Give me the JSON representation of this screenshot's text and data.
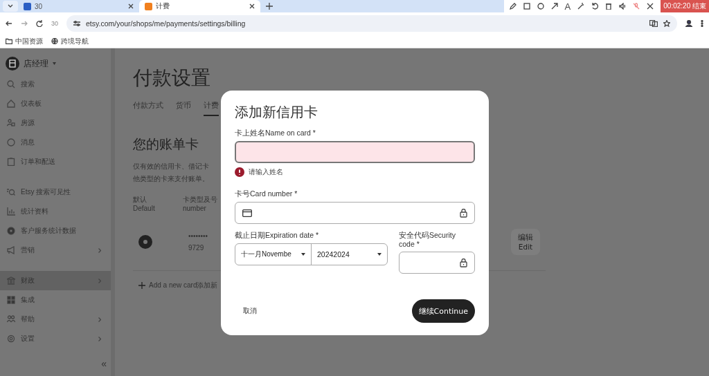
{
  "browser": {
    "tabs": [
      {
        "label": "30",
        "selected": false
      },
      {
        "label": "计费",
        "selected": true
      }
    ],
    "recorder": {
      "text_tool": "A",
      "timer": "00:02:20 结束"
    },
    "reload_badge": "30",
    "url": "etsy.com/your/shops/me/payments/settings/billing",
    "bookmarks": [
      "中国资源",
      "跨境导航"
    ]
  },
  "sidebar": {
    "shop": "店经理",
    "sections": [
      {
        "items": [
          {
            "label": "搜索",
            "selected": false,
            "submenu": false
          },
          {
            "label": "仪表板",
            "selected": false,
            "submenu": false
          },
          {
            "label": "房源",
            "selected": false,
            "submenu": false
          },
          {
            "label": "消息",
            "selected": false,
            "submenu": false
          },
          {
            "label": "订单和配送",
            "selected": false,
            "submenu": false
          }
        ]
      },
      {
        "items": [
          {
            "label": "Etsy 搜索可见性",
            "selected": false,
            "submenu": false
          },
          {
            "label": "统计资料",
            "selected": false,
            "submenu": false
          },
          {
            "label": "客户服务统计数据",
            "selected": false,
            "submenu": false
          },
          {
            "label": "营销",
            "selected": false,
            "submenu": true
          }
        ]
      },
      {
        "items": [
          {
            "label": "财政",
            "selected": true,
            "submenu": true
          },
          {
            "label": "集成",
            "selected": false,
            "submenu": false
          },
          {
            "label": "帮助",
            "selected": false,
            "submenu": true
          },
          {
            "label": "设置",
            "selected": false,
            "submenu": true
          }
        ]
      }
    ],
    "collapse": "«"
  },
  "page": {
    "title": "付款设置",
    "tabs": [
      {
        "label": "付款方式",
        "selected": false
      },
      {
        "label": "货币",
        "selected": false
      },
      {
        "label": "计费",
        "selected": true
      }
    ],
    "heading": "您的账单卡",
    "description_lines": [
      "仅有效的信用卡、借记卡",
      "他类型的卡来支付账单。"
    ],
    "table": {
      "columns": [
        [
          "默认",
          "Default"
        ],
        [
          "卡类型及号",
          "number"
        ]
      ],
      "rows": [
        {
          "selected": true,
          "card_mask": "••••••••",
          "card_last4": "9729",
          "edit": [
            "编辑",
            "Edit"
          ]
        }
      ]
    },
    "add_card": "Add a new card添加新"
  },
  "dialog": {
    "title": "添加新信用卡",
    "name_field": {
      "label": "卡上姓名Name on card *",
      "error": true,
      "error_message": "请输入姓名"
    },
    "card_field": {
      "label": "卡号Card number *"
    },
    "expiration": {
      "label": "截止日期Expiration date *",
      "month": "十一月Novembe",
      "year": "20242024"
    },
    "security": {
      "label": "安全代码Security code *"
    },
    "cancel": "取消",
    "continue": "继续Continue"
  }
}
